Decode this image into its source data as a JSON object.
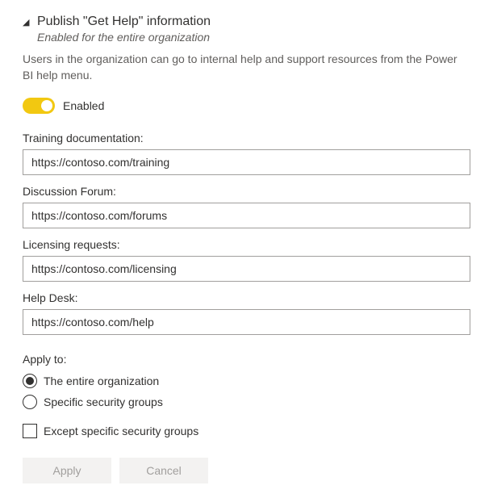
{
  "header": {
    "title": "Publish \"Get Help\" information",
    "subtitle": "Enabled for the entire organization",
    "description": "Users in the organization can go to internal help and support resources from the Power BI help menu."
  },
  "toggle": {
    "state_label": "Enabled",
    "enabled": true
  },
  "fields": {
    "training": {
      "label": "Training documentation:",
      "value": "https://contoso.com/training"
    },
    "forum": {
      "label": "Discussion Forum:",
      "value": "https://contoso.com/forums"
    },
    "licensing": {
      "label": "Licensing requests:",
      "value": "https://contoso.com/licensing"
    },
    "helpdesk": {
      "label": "Help Desk:",
      "value": "https://contoso.com/help"
    }
  },
  "apply": {
    "label": "Apply to:",
    "options": {
      "entire_org": "The entire organization",
      "specific_groups": "Specific security groups"
    },
    "except_label": "Except specific security groups"
  },
  "buttons": {
    "apply": "Apply",
    "cancel": "Cancel"
  }
}
